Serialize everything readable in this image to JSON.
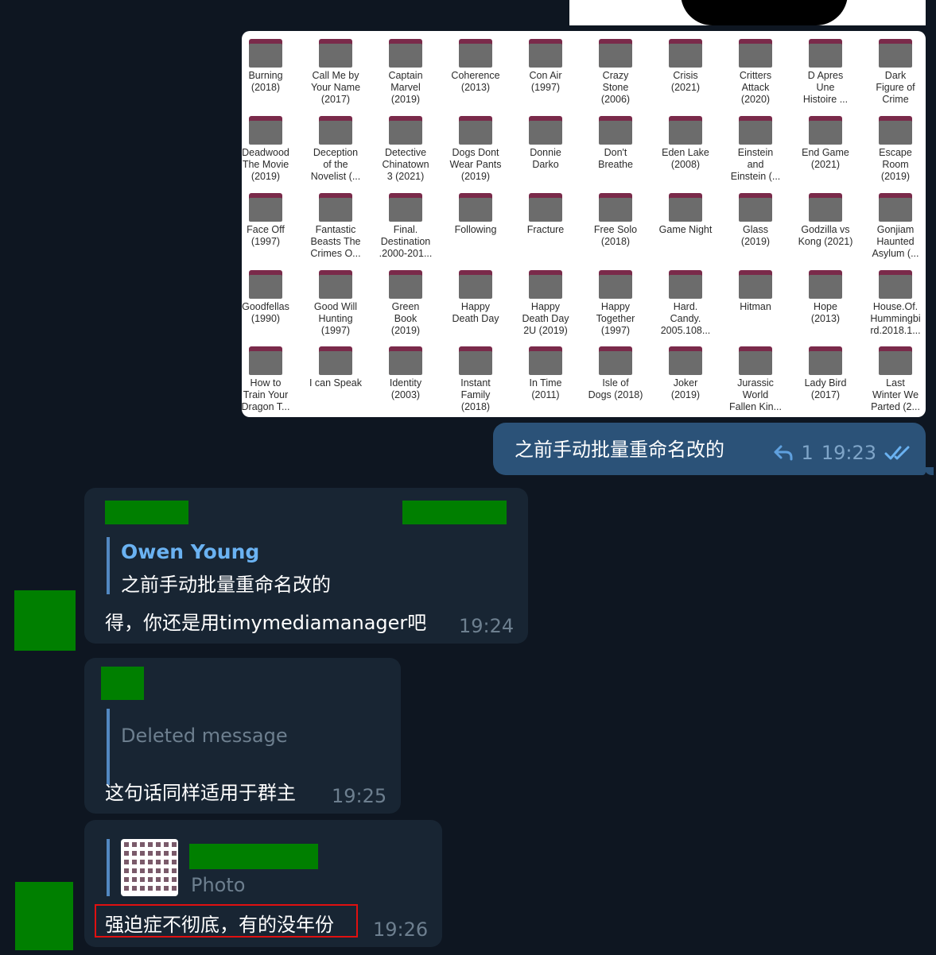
{
  "photo_grid": [
    [
      "Burning\n(2018)",
      "Call Me by\nYour Name\n(2017)",
      "Captain\nMarvel\n(2019)",
      "Coherence\n(2013)",
      "Con Air\n(1997)",
      "Crazy\nStone\n(2006)",
      "Crisis\n(2021)",
      "Critters\nAttack\n(2020)",
      "D Apres\nUne\nHistoire ...",
      "Dark\nFigure of\nCrime"
    ],
    [
      "Deadwood\nThe Movie\n(2019)",
      "Deception\nof the\nNovelist (...",
      "Detective\nChinatown\n3 (2021)",
      "Dogs Dont\nWear Pants\n(2019)",
      "Donnie\nDarko",
      "Don't\nBreathe",
      "Eden Lake\n(2008)",
      "Einstein\nand\nEinstein (...",
      "End Game\n(2021)",
      "Escape\nRoom\n(2019)"
    ],
    [
      "Face Off\n(1997)",
      "Fantastic\nBeasts The\nCrimes O...",
      "Final.\nDestination\n.2000-201...",
      "Following",
      "Fracture",
      "Free Solo\n(2018)",
      "Game Night",
      "Glass\n(2019)",
      "Godzilla vs\nKong (2021)",
      "Gonjiam\nHaunted\nAsylum (..."
    ],
    [
      "Goodfellas\n(1990)",
      "Good Will\nHunting\n(1997)",
      "Green\nBook\n(2019)",
      "Happy\nDeath Day",
      "Happy\nDeath Day\n2U (2019)",
      "Happy\nTogether\n(1997)",
      "Hard.\nCandy.\n2005.108...",
      "Hitman",
      "Hope\n(2013)",
      "House.Of.\nHummingbi\nrd.2018.1..."
    ],
    [
      "How to\nTrain Your\nDragon T...",
      "I can Speak",
      "Identity\n(2003)",
      "Instant\nFamily\n(2018)",
      "In Time\n(2011)",
      "Isle of\nDogs (2018)",
      "Joker\n(2019)",
      "Jurassic\nWorld\nFallen Kin...",
      "Lady Bird\n(2017)",
      "Last\nWinter We\nParted (2..."
    ]
  ],
  "outgoing": {
    "text": "之前手动批量重命名改的",
    "reply_count": "1",
    "time": "19:23"
  },
  "msg1": {
    "reply_name": "Owen Young",
    "reply_text": "之前手动批量重命名改的",
    "text": "得，你还是用timymediamanager吧",
    "time": "19:24"
  },
  "msg2": {
    "reply_text": "Deleted message",
    "text": "这句话同样适用于群主",
    "time": "19:25"
  },
  "msg3": {
    "reply_text": "Photo",
    "text": "强迫症不彻底，有的没年份",
    "time": "19:26"
  },
  "colors": {
    "background": "#0e1621",
    "outgoing_bubble": "#2b5278",
    "incoming_bubble": "#182533",
    "accent": "#5288c1",
    "name": "#6ab2f2",
    "redaction": "#007f00",
    "highlight": "#e01010"
  }
}
